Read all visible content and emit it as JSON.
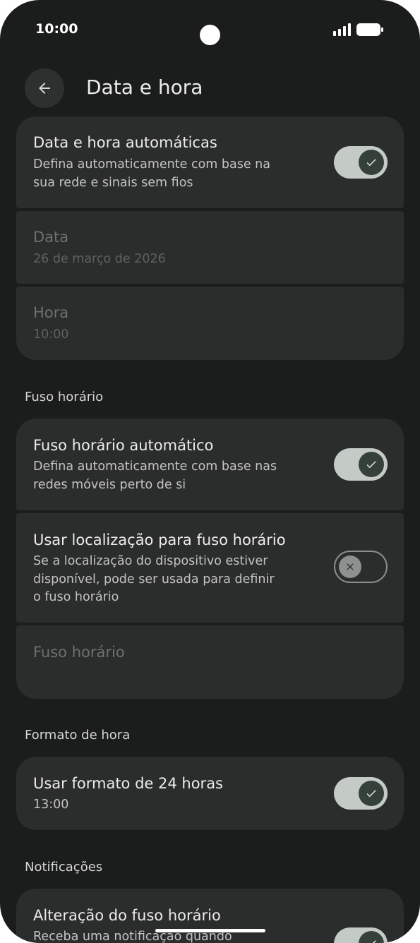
{
  "status_bar": {
    "time": "10:00"
  },
  "header": {
    "title": "Data e hora",
    "back_icon": "arrow-left-icon"
  },
  "group1": {
    "auto_datetime": {
      "title": "Data e hora automáticas",
      "subtitle_line1": "Defina automaticamente com base na",
      "subtitle_line2": "sua rede e sinais sem fios",
      "enabled": true
    },
    "date": {
      "title": "Data",
      "value": "26 de março de 2026"
    },
    "time": {
      "title": "Hora",
      "value": "10:00"
    }
  },
  "timezone_section": {
    "label": "Fuso horário",
    "auto_timezone": {
      "title": "Fuso horário automático",
      "subtitle_line1": "Defina automaticamente com base nas",
      "subtitle_line2": "redes móveis perto de si",
      "enabled": true
    },
    "use_location": {
      "title": "Usar localização para fuso horário",
      "subtitle_line1": "Se a localização do dispositivo estiver",
      "subtitle_line2": "disponível, pode ser usada para definir",
      "subtitle_line3": "o fuso horário",
      "enabled": false
    },
    "timezone": {
      "title": "Fuso horário"
    }
  },
  "time_format_section": {
    "label": "Formato de hora",
    "use_24h": {
      "title": "Usar formato de 24 horas",
      "subtitle": "13:00",
      "enabled": true
    }
  },
  "notifications_section": {
    "label": "Notificações",
    "tz_change": {
      "title": "Alteração do fuso horário",
      "subtitle_line1": "Receba uma notificação quando",
      "enabled": true
    }
  },
  "colors": {
    "background": "#1b1c1c",
    "card": "#2b2c2c",
    "switch_on_track": "#c4cac6",
    "switch_on_knob": "#344039"
  }
}
